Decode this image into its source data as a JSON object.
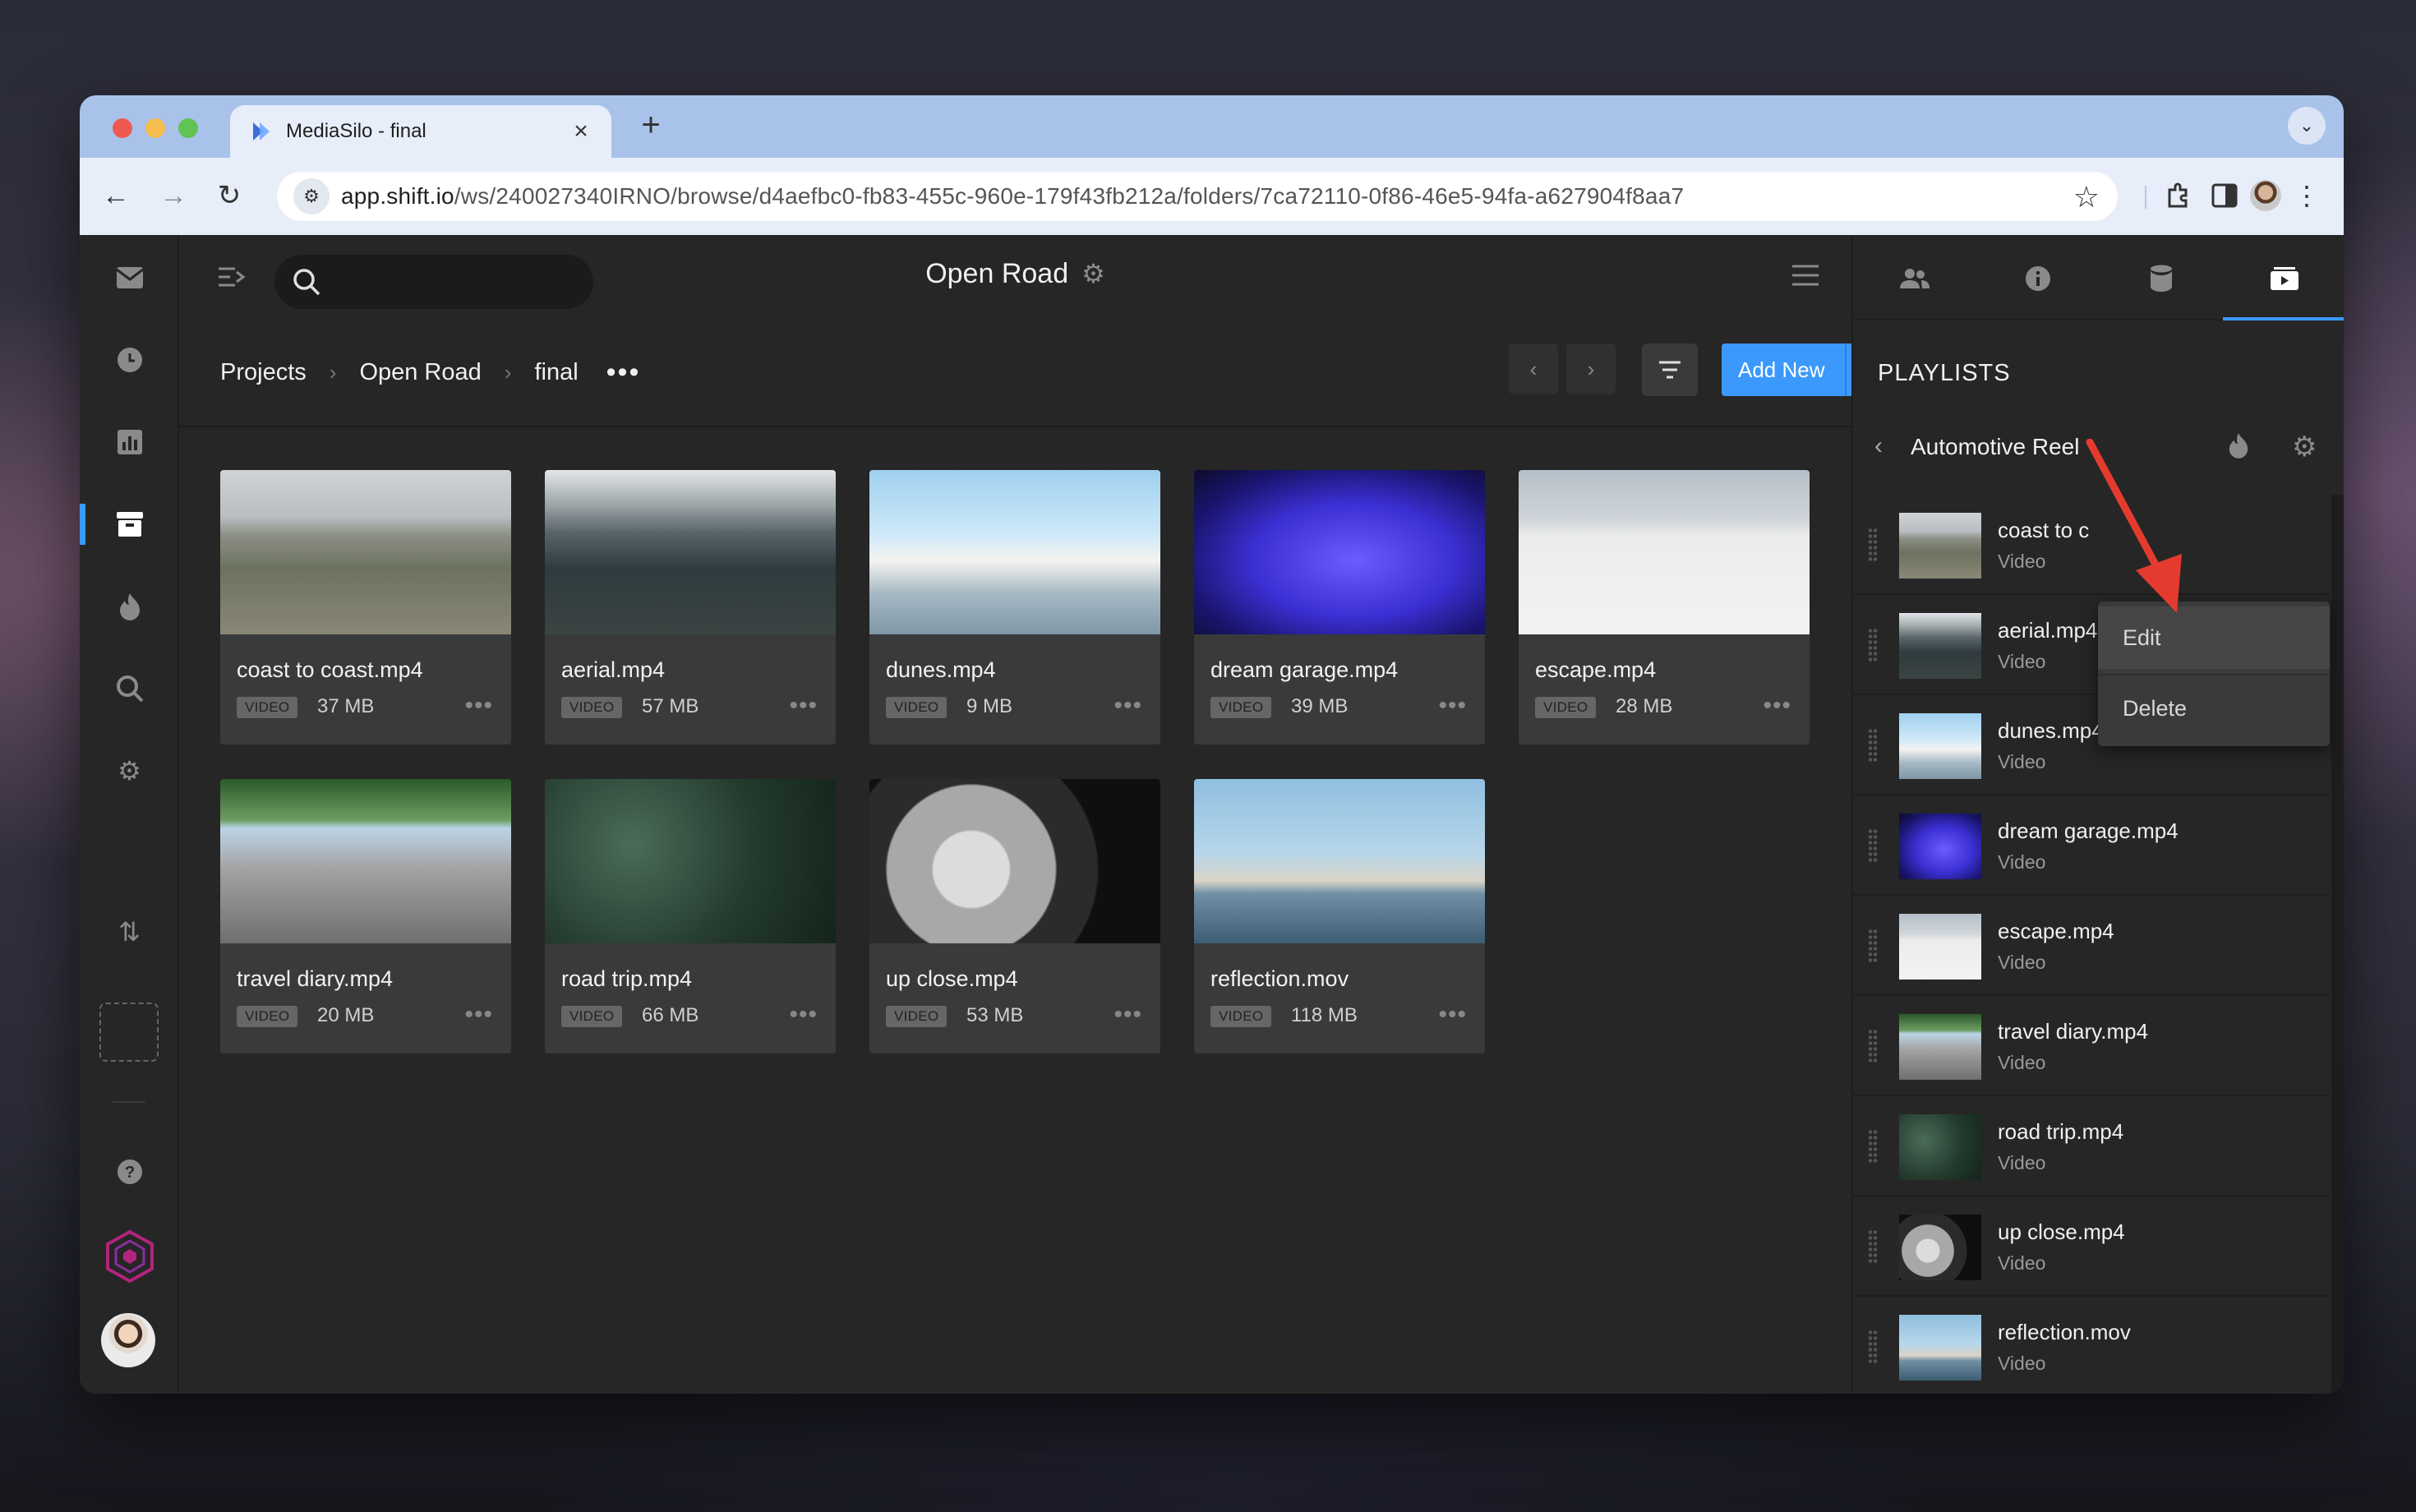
{
  "browser": {
    "tab_title": "MediaSilo - final",
    "url_host": "app.shift.io",
    "url_path": "/ws/240027340IRNO/browse/d4aefbc0-fb83-455c-960e-179f43fb212a/folders/7ca72110-0f86-46e5-94fa-a627904f8aa7"
  },
  "header": {
    "project_title": "Open Road",
    "search_placeholder": ""
  },
  "breadcrumb": {
    "items": [
      "Projects",
      "Open Road",
      "final"
    ],
    "more": "•••"
  },
  "toolbar": {
    "add_new_label": "Add New"
  },
  "assets": [
    {
      "name": "coast to coast.mp4",
      "type": "VIDEO",
      "size": "37 MB",
      "thumb": "coast"
    },
    {
      "name": "aerial.mp4",
      "type": "VIDEO",
      "size": "57 MB",
      "thumb": "aerial"
    },
    {
      "name": "dunes.mp4",
      "type": "VIDEO",
      "size": "9 MB",
      "thumb": "dunes"
    },
    {
      "name": "dream garage.mp4",
      "type": "VIDEO",
      "size": "39 MB",
      "thumb": "dream"
    },
    {
      "name": "escape.mp4",
      "type": "VIDEO",
      "size": "28 MB",
      "thumb": "escape"
    },
    {
      "name": "travel diary.mp4",
      "type": "VIDEO",
      "size": "20 MB",
      "thumb": "travel"
    },
    {
      "name": "road trip.mp4",
      "type": "VIDEO",
      "size": "66 MB",
      "thumb": "road"
    },
    {
      "name": "up close.mp4",
      "type": "VIDEO",
      "size": "53 MB",
      "thumb": "up"
    },
    {
      "name": "reflection.mov",
      "type": "VIDEO",
      "size": "118 MB",
      "thumb": "refl"
    }
  ],
  "panel": {
    "heading": "PLAYLISTS",
    "playlist_name": "Automotive Reel",
    "items": [
      {
        "name": "coast to c",
        "kind": "Video",
        "thumb": "coast"
      },
      {
        "name": "aerial.mp4",
        "kind": "Video",
        "thumb": "aerial"
      },
      {
        "name": "dunes.mp4",
        "kind": "Video",
        "thumb": "dunes"
      },
      {
        "name": "dream garage.mp4",
        "kind": "Video",
        "thumb": "dream"
      },
      {
        "name": "escape.mp4",
        "kind": "Video",
        "thumb": "escape"
      },
      {
        "name": "travel diary.mp4",
        "kind": "Video",
        "thumb": "travel"
      },
      {
        "name": "road trip.mp4",
        "kind": "Video",
        "thumb": "road"
      },
      {
        "name": "up close.mp4",
        "kind": "Video",
        "thumb": "up"
      },
      {
        "name": "reflection.mov",
        "kind": "Video",
        "thumb": "refl"
      }
    ]
  },
  "context_menu": {
    "items": [
      "Edit",
      "Delete"
    ]
  },
  "colors": {
    "accent": "#3b99fc",
    "app_bg": "#262626",
    "card_bg": "#3a3a3a",
    "annotation_arrow": "#e53b2f"
  }
}
